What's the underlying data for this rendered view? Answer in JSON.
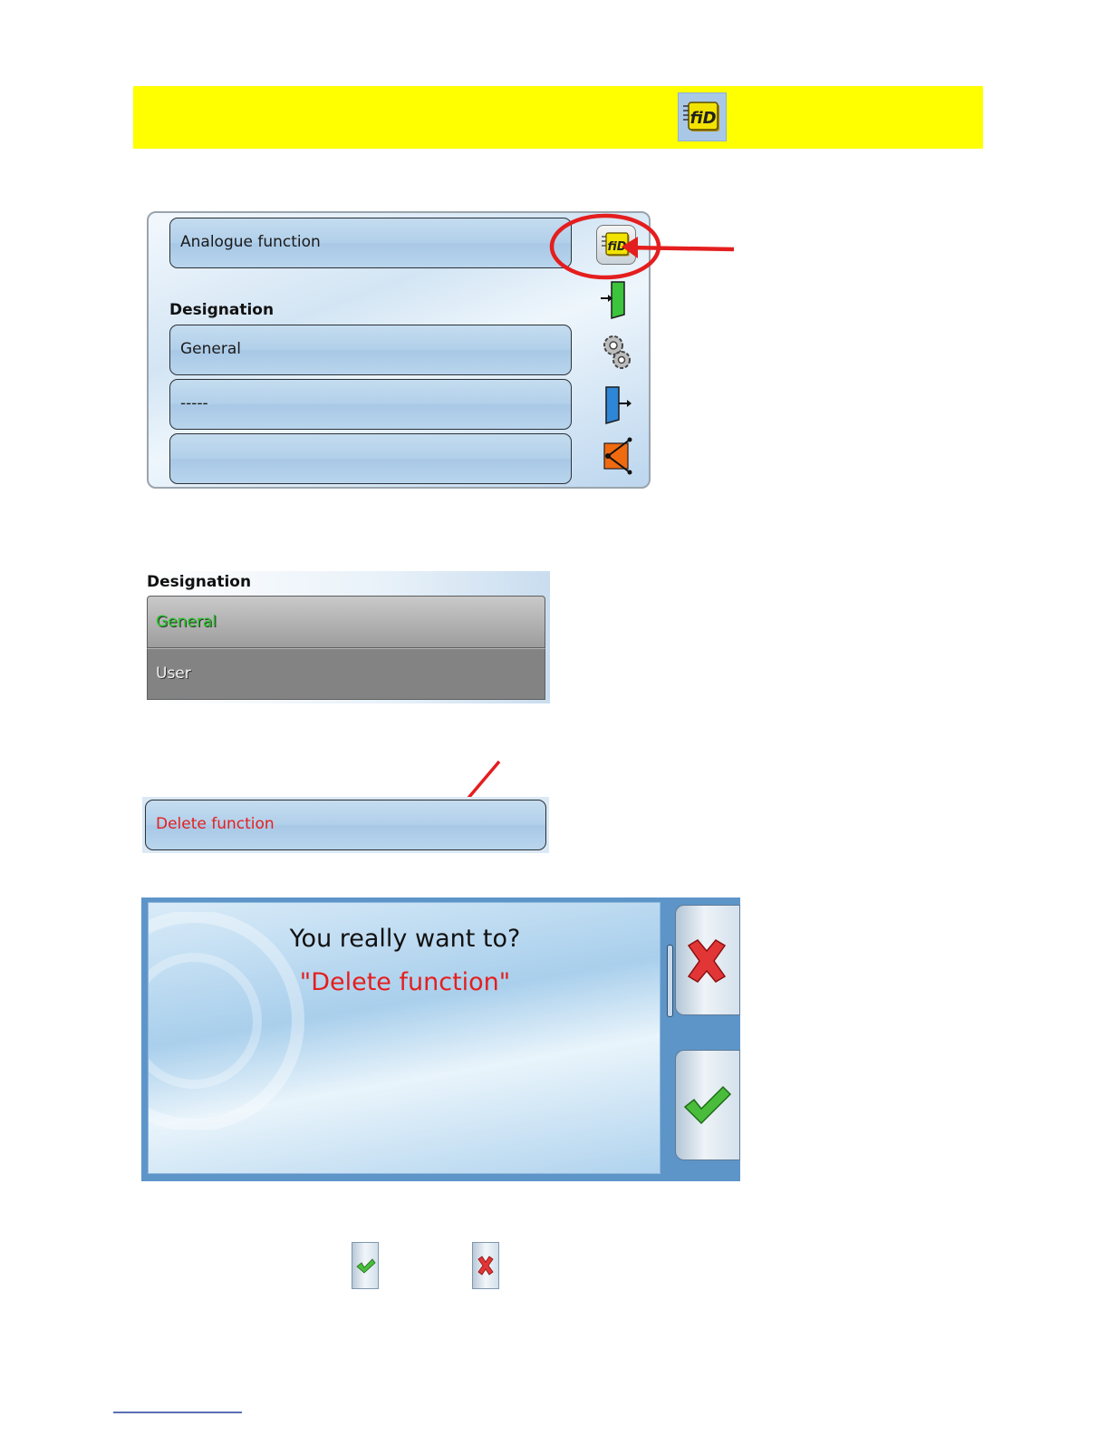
{
  "panel_main": {
    "field_function": "Analogue function",
    "designation_label": "Designation",
    "field_designation": "General",
    "field_index": "-----",
    "field_empty": ""
  },
  "designation_list": {
    "label": "Designation",
    "options": [
      "General",
      "User"
    ],
    "selected": "General"
  },
  "delete_field": {
    "label": "Delete function"
  },
  "confirm_dialog": {
    "question": "You really want to?",
    "action": "\"Delete function\""
  },
  "icons": {
    "header": "fid-icon",
    "panel_side": [
      "fid-icon",
      "input-icon",
      "gears-icon",
      "output-icon",
      "network-icon"
    ],
    "dialog": [
      "cancel-x-icon",
      "confirm-check-icon"
    ],
    "bottom": [
      "check-button-icon",
      "x-button-icon"
    ]
  },
  "colors": {
    "banner": "#ffff00",
    "annotation": "#e41e1e",
    "selected_text": "#27c427",
    "delete_text": "#e41e1e"
  }
}
